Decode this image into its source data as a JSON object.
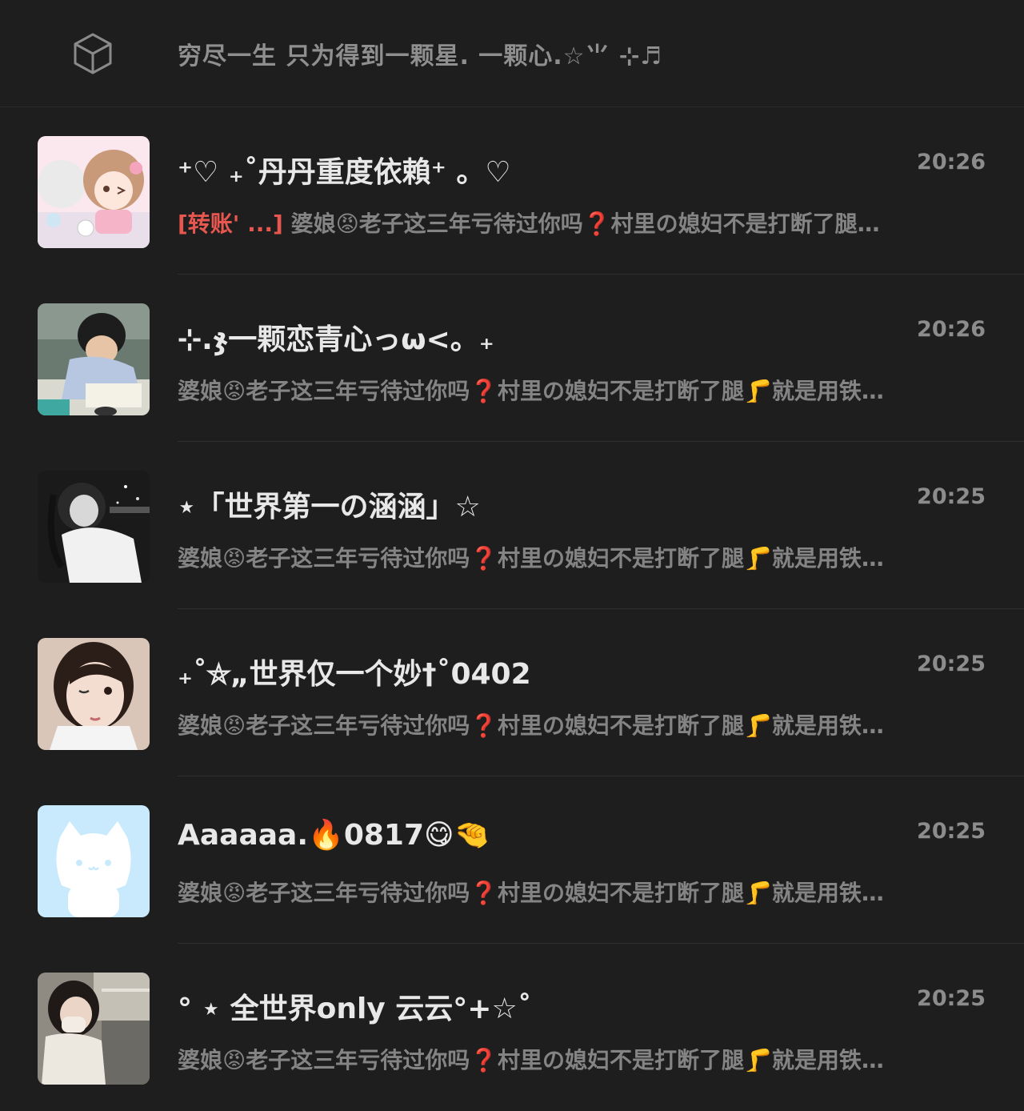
{
  "header": {
    "title": "穷尽一生  只为得到一颗星. 一颗心.☆⺌ ⊹♬",
    "icon": "cube-icon"
  },
  "chats": [
    {
      "name": "⁺♡ ₊˚丹丹重度依賴⁺ 。♡",
      "time": "20:26",
      "tag": "[转账' ...]",
      "preview": " 婆娘😡老子这三年亏待过你吗❓村里の媳妇不是打断了腿…",
      "avatar": "anime-girl-avatar"
    },
    {
      "name": "⊹.ჯ一颗恋青心っω<。₊",
      "time": "20:26",
      "tag": "",
      "preview": "婆娘😡老子这三年亏待过你吗❓村里の媳妇不是打断了腿🦵就是用铁…",
      "avatar": "boy-writing-avatar"
    },
    {
      "name": "⋆「世界第一の涵涵」☆",
      "time": "20:25",
      "tag": "",
      "preview": "婆娘😡老子这三年亏待过你吗❓村里の媳妇不是打断了腿🦵就是用铁…",
      "avatar": "girl-night-avatar"
    },
    {
      "name": "₊˚⛤„世界仅一个妙†˚0402",
      "time": "20:25",
      "tag": "",
      "preview": "婆娘😡老子这三年亏待过你吗❓村里の媳妇不是打断了腿🦵就是用铁…",
      "avatar": "girl-wink-avatar"
    },
    {
      "name": "Aaaaaa.🔥0817😋🤏",
      "time": "20:25",
      "tag": "",
      "preview": "婆娘😡老子这三年亏待过你吗❓村里の媳妇不是打断了腿🦵就是用铁…",
      "avatar": "white-cat-avatar"
    },
    {
      "name": "° ⋆ 全世界only     云云°+☆˚",
      "time": "20:25",
      "tag": "",
      "preview": "婆娘😡老子这三年亏待过你吗❓村里の媳妇不是打断了腿🦵就是用铁…",
      "avatar": "girl-mall-avatar"
    }
  ]
}
